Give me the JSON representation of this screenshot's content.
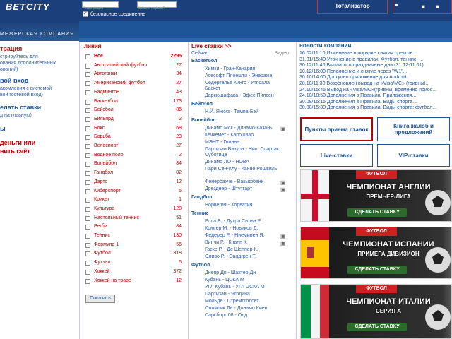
{
  "header": {
    "logo": "BETCITY",
    "company": "МЕЖЕРСКАЯ КОМПАНИЯ",
    "hint1": "Регистрация",
    "hint2": "Забыли пароль?",
    "secure_label": "безопасное соединение",
    "toto": "Тотализатор"
  },
  "left": {
    "sec1": "трация",
    "sec1_text": [
      "стрируйтесь для",
      "ования дополнительных",
      "ований)"
    ],
    "sec2": "вой вход",
    "sec2_text": [
      "акомления с системой",
      "вой гостевой вход)"
    ],
    "sec3": "елать ставки",
    "sec3_text": [
      "д на главную)"
    ],
    "sec4": "ы",
    "sec5": "деньги или",
    "sec5b": "нить счёт"
  },
  "sports": {
    "heading": "линия",
    "items": [
      {
        "name": "Все",
        "count": "2295"
      },
      {
        "name": "Австралийский футбол",
        "count": "27"
      },
      {
        "name": "Автогонки",
        "count": "34"
      },
      {
        "name": "Американский футбол",
        "count": "27"
      },
      {
        "name": "Бадминтон",
        "count": "43"
      },
      {
        "name": "Баскетбол",
        "count": "173"
      },
      {
        "name": "Бейсбол",
        "count": "86"
      },
      {
        "name": "Бильярд",
        "count": "2"
      },
      {
        "name": "Бокс",
        "count": "68"
      },
      {
        "name": "Борьба",
        "count": "23"
      },
      {
        "name": "Велоспорт",
        "count": "27"
      },
      {
        "name": "Водное поло",
        "count": "2"
      },
      {
        "name": "Волейбол",
        "count": "84"
      },
      {
        "name": "Гандбол",
        "count": "82"
      },
      {
        "name": "Дартс",
        "count": "12"
      },
      {
        "name": "Киберспорт",
        "count": "5"
      },
      {
        "name": "Крикет",
        "count": "1"
      },
      {
        "name": "Культура",
        "count": "128"
      },
      {
        "name": "Настольный теннис",
        "count": "51"
      },
      {
        "name": "Регби",
        "count": "84"
      },
      {
        "name": "Теннис",
        "count": "130"
      },
      {
        "name": "Формула 1",
        "count": "56"
      },
      {
        "name": "Футбол",
        "count": "818"
      },
      {
        "name": "Футзал",
        "count": "5"
      },
      {
        "name": "Хоккей",
        "count": "372"
      },
      {
        "name": "Хоккей на траве",
        "count": "12"
      }
    ],
    "show_button": "Показать"
  },
  "live": {
    "heading": "Live ставки >>",
    "now": "Сейчас:",
    "video": "Видео",
    "cats": [
      {
        "name": "Баскетбол",
        "matches": [
          "Химки - Гран-Канария",
          "Асесофт Плоешти - Энеража",
          "Седертелье Кингс - Уппсала Баскет",
          "Даркюшафака - Эфес Пилсен"
        ]
      },
      {
        "name": "Бейсбол",
        "matches": [
          "Н.Й. Янкиз - Тампа-Бэй"
        ]
      },
      {
        "name": "Волейбол",
        "matches": [
          "Динамо Мск - Динамо-Казань",
          "Кечкемет - Капошвар",
          "МЭНТ - Гвинна",
          "Партизан Визура - Ниш Спартак Суботица",
          "Динамо ЛО - НОВА",
          "Пари Сен-Клу - Канне Рошвиль",
          "Фенербахче - Вакыфбанк",
          "Дрезднер - Штутгарт"
        ]
      },
      {
        "name": "Гандбол",
        "matches": [
          "Норвегия - Хорватия"
        ]
      },
      {
        "name": "Теннис",
        "matches": [
          "Рола Б. - Дутра Силва Р.",
          "Крюгер М. - Новиков Д.",
          "Федерер Р. - Ниеминен Я.",
          "Винчи Р. - Кнапп К.",
          "Гаске Р. - Де Шеппер К.",
          "Оливо Р. - Сандгрен Т."
        ]
      },
      {
        "name": "Футбол",
        "matches": [
          "Днепр Дп - Шахтер Дн",
          "Кубань - ЦСКА М",
          "УГЛ Кубань - УГЛ ЦСКА М",
          "Партизан - Ягодина",
          "Мольде - Стремсгодсет",
          "Олимпик Дн - Динамо Киев",
          "Сарсборг 08 - Одд"
        ]
      }
    ]
  },
  "news": {
    "heading": "новости компании",
    "items": [
      "16.02/11:10 Изменение в порядке снятия средств...",
      "31.01/15:40 Уточнение в правилах: Футбол, теннис, ...",
      "30.12/11:40 Выплаты в праздничные дни (31.12-11.01)",
      "10.12/16:00 Пополнение и снятие через \"W1\"...",
      "30.10/14:00 Доступно приложение для Android...",
      "28.10/11:30 Возобновлен вывод на «Visa/MC» (гривны)...",
      "24.10/15:45 Вывод на «Visa/MC»(гривны) временно приос...",
      "24.10/18:50 Дополнения в Правила. Приложения...",
      "30.08/15:15 Дополнения в Правила. Виды спорта...",
      "30.08/15:30 Дополнения в Правила. Виды спорта: футбол..."
    ],
    "buttons": [
      "Пункты приема ставок",
      "Книга жалоб и предложений",
      "Live-ставки",
      "VIP-ставки"
    ]
  },
  "banners": [
    {
      "tag": "ФУТБОЛ",
      "title": "ЧЕМПИОНАТ АНГЛИИ",
      "sub": "ПРЕМЬЕР-ЛИГА",
      "cta": "СДЕЛАТЬ СТАВКУ"
    },
    {
      "tag": "ФУТБОЛ",
      "title": "ЧЕМПИОНАТ ИСПАНИИ",
      "sub": "ПРИМЕРА ДИВИЗИОН",
      "cta": "СДЕЛАТЬ СТАВКУ"
    },
    {
      "tag": "ФУТБОЛ",
      "title": "ЧЕМПИОНАТ ИТАЛИИ",
      "sub": "СЕРИЯ А",
      "cta": "СДЕЛАТЬ СТАВКУ"
    }
  ]
}
